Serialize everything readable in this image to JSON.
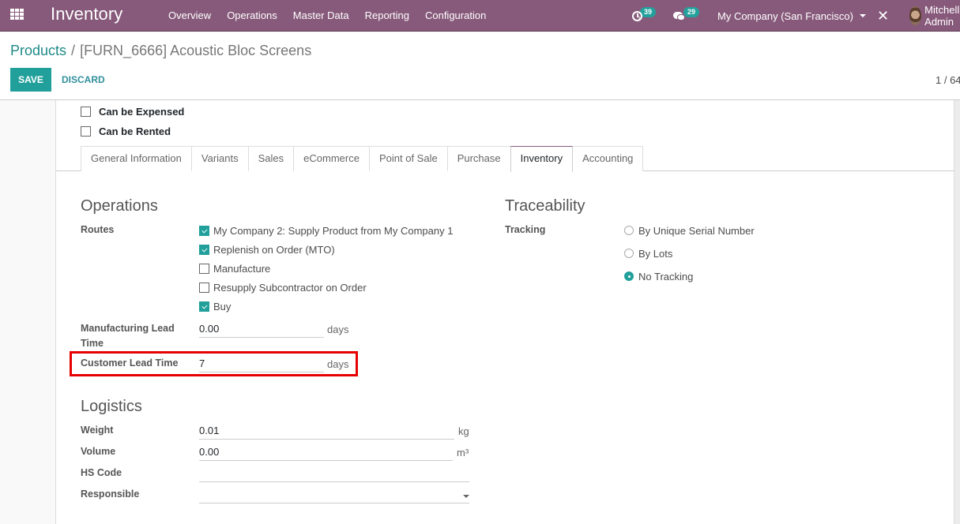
{
  "navbar": {
    "app_name": "Inventory",
    "menu": [
      "Overview",
      "Operations",
      "Master Data",
      "Reporting",
      "Configuration"
    ],
    "activity_count": "39",
    "message_count": "29",
    "company": "My Company (San Francisco)",
    "user_name": "Mitchell Admin",
    "icons": {
      "apps": "grid-icon",
      "activity": "clock-icon",
      "messages": "chat-icon",
      "tools": "tools-icon"
    }
  },
  "control_panel": {
    "breadcrumb_parent": "Products",
    "breadcrumb_separator": "/",
    "breadcrumb_current": "[FURN_6666] Acoustic Bloc Screens",
    "save_label": "SAVE",
    "discard_label": "DISCARD",
    "pager": "1 / 64"
  },
  "form": {
    "top_checkboxes": [
      {
        "label": "Can be Expensed",
        "checked": false
      },
      {
        "label": "Can be Rented",
        "checked": false
      }
    ],
    "tabs": [
      {
        "label": "General Information",
        "active": false
      },
      {
        "label": "Variants",
        "active": false
      },
      {
        "label": "Sales",
        "active": false
      },
      {
        "label": "eCommerce",
        "active": false
      },
      {
        "label": "Point of Sale",
        "active": false
      },
      {
        "label": "Purchase",
        "active": false
      },
      {
        "label": "Inventory",
        "active": true
      },
      {
        "label": "Accounting",
        "active": false
      }
    ],
    "operations": {
      "title": "Operations",
      "routes_label": "Routes",
      "routes": [
        {
          "label": "My Company 2: Supply Product from My Company 1",
          "checked": true
        },
        {
          "label": "Replenish on Order (MTO)",
          "checked": true
        },
        {
          "label": "Manufacture",
          "checked": false
        },
        {
          "label": "Resupply Subcontractor on Order",
          "checked": false
        },
        {
          "label": "Buy",
          "checked": true
        }
      ],
      "manufacturing_lead_time_label": "Manufacturing Lead Time",
      "manufacturing_lead_time_value": "0.00",
      "manufacturing_lead_time_unit": "days",
      "customer_lead_time_label": "Customer Lead Time",
      "customer_lead_time_value": "7",
      "customer_lead_time_unit": "days"
    },
    "traceability": {
      "title": "Traceability",
      "tracking_label": "Tracking",
      "options": [
        {
          "label": "By Unique Serial Number",
          "selected": false
        },
        {
          "label": "By Lots",
          "selected": false
        },
        {
          "label": "No Tracking",
          "selected": true
        }
      ]
    },
    "logistics": {
      "title": "Logistics",
      "weight_label": "Weight",
      "weight_value": "0.01",
      "weight_unit": "kg",
      "volume_label": "Volume",
      "volume_value": "0.00",
      "volume_unit": "m³",
      "hs_code_label": "HS Code",
      "hs_code_value": "",
      "responsible_label": "Responsible",
      "responsible_value": ""
    }
  },
  "colors": {
    "navbar": "#875a7b",
    "primary": "#21a09b",
    "highlight": "#e60000"
  }
}
